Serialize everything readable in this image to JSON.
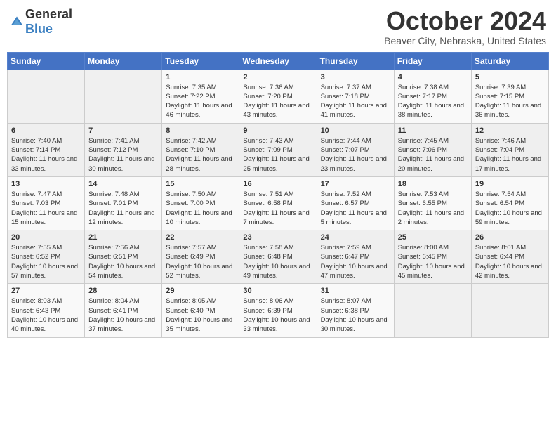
{
  "header": {
    "logo": {
      "general": "General",
      "blue": "Blue"
    },
    "title": "October 2024",
    "subtitle": "Beaver City, Nebraska, United States"
  },
  "weekdays": [
    "Sunday",
    "Monday",
    "Tuesday",
    "Wednesday",
    "Thursday",
    "Friday",
    "Saturday"
  ],
  "weeks": [
    [
      {
        "day": "",
        "info": ""
      },
      {
        "day": "",
        "info": ""
      },
      {
        "day": "1",
        "sunrise": "Sunrise: 7:35 AM",
        "sunset": "Sunset: 7:22 PM",
        "daylight": "Daylight: 11 hours and 46 minutes."
      },
      {
        "day": "2",
        "sunrise": "Sunrise: 7:36 AM",
        "sunset": "Sunset: 7:20 PM",
        "daylight": "Daylight: 11 hours and 43 minutes."
      },
      {
        "day": "3",
        "sunrise": "Sunrise: 7:37 AM",
        "sunset": "Sunset: 7:18 PM",
        "daylight": "Daylight: 11 hours and 41 minutes."
      },
      {
        "day": "4",
        "sunrise": "Sunrise: 7:38 AM",
        "sunset": "Sunset: 7:17 PM",
        "daylight": "Daylight: 11 hours and 38 minutes."
      },
      {
        "day": "5",
        "sunrise": "Sunrise: 7:39 AM",
        "sunset": "Sunset: 7:15 PM",
        "daylight": "Daylight: 11 hours and 36 minutes."
      }
    ],
    [
      {
        "day": "6",
        "sunrise": "Sunrise: 7:40 AM",
        "sunset": "Sunset: 7:14 PM",
        "daylight": "Daylight: 11 hours and 33 minutes."
      },
      {
        "day": "7",
        "sunrise": "Sunrise: 7:41 AM",
        "sunset": "Sunset: 7:12 PM",
        "daylight": "Daylight: 11 hours and 30 minutes."
      },
      {
        "day": "8",
        "sunrise": "Sunrise: 7:42 AM",
        "sunset": "Sunset: 7:10 PM",
        "daylight": "Daylight: 11 hours and 28 minutes."
      },
      {
        "day": "9",
        "sunrise": "Sunrise: 7:43 AM",
        "sunset": "Sunset: 7:09 PM",
        "daylight": "Daylight: 11 hours and 25 minutes."
      },
      {
        "day": "10",
        "sunrise": "Sunrise: 7:44 AM",
        "sunset": "Sunset: 7:07 PM",
        "daylight": "Daylight: 11 hours and 23 minutes."
      },
      {
        "day": "11",
        "sunrise": "Sunrise: 7:45 AM",
        "sunset": "Sunset: 7:06 PM",
        "daylight": "Daylight: 11 hours and 20 minutes."
      },
      {
        "day": "12",
        "sunrise": "Sunrise: 7:46 AM",
        "sunset": "Sunset: 7:04 PM",
        "daylight": "Daylight: 11 hours and 17 minutes."
      }
    ],
    [
      {
        "day": "13",
        "sunrise": "Sunrise: 7:47 AM",
        "sunset": "Sunset: 7:03 PM",
        "daylight": "Daylight: 11 hours and 15 minutes."
      },
      {
        "day": "14",
        "sunrise": "Sunrise: 7:48 AM",
        "sunset": "Sunset: 7:01 PM",
        "daylight": "Daylight: 11 hours and 12 minutes."
      },
      {
        "day": "15",
        "sunrise": "Sunrise: 7:50 AM",
        "sunset": "Sunset: 7:00 PM",
        "daylight": "Daylight: 11 hours and 10 minutes."
      },
      {
        "day": "16",
        "sunrise": "Sunrise: 7:51 AM",
        "sunset": "Sunset: 6:58 PM",
        "daylight": "Daylight: 11 hours and 7 minutes."
      },
      {
        "day": "17",
        "sunrise": "Sunrise: 7:52 AM",
        "sunset": "Sunset: 6:57 PM",
        "daylight": "Daylight: 11 hours and 5 minutes."
      },
      {
        "day": "18",
        "sunrise": "Sunrise: 7:53 AM",
        "sunset": "Sunset: 6:55 PM",
        "daylight": "Daylight: 11 hours and 2 minutes."
      },
      {
        "day": "19",
        "sunrise": "Sunrise: 7:54 AM",
        "sunset": "Sunset: 6:54 PM",
        "daylight": "Daylight: 10 hours and 59 minutes."
      }
    ],
    [
      {
        "day": "20",
        "sunrise": "Sunrise: 7:55 AM",
        "sunset": "Sunset: 6:52 PM",
        "daylight": "Daylight: 10 hours and 57 minutes."
      },
      {
        "day": "21",
        "sunrise": "Sunrise: 7:56 AM",
        "sunset": "Sunset: 6:51 PM",
        "daylight": "Daylight: 10 hours and 54 minutes."
      },
      {
        "day": "22",
        "sunrise": "Sunrise: 7:57 AM",
        "sunset": "Sunset: 6:49 PM",
        "daylight": "Daylight: 10 hours and 52 minutes."
      },
      {
        "day": "23",
        "sunrise": "Sunrise: 7:58 AM",
        "sunset": "Sunset: 6:48 PM",
        "daylight": "Daylight: 10 hours and 49 minutes."
      },
      {
        "day": "24",
        "sunrise": "Sunrise: 7:59 AM",
        "sunset": "Sunset: 6:47 PM",
        "daylight": "Daylight: 10 hours and 47 minutes."
      },
      {
        "day": "25",
        "sunrise": "Sunrise: 8:00 AM",
        "sunset": "Sunset: 6:45 PM",
        "daylight": "Daylight: 10 hours and 45 minutes."
      },
      {
        "day": "26",
        "sunrise": "Sunrise: 8:01 AM",
        "sunset": "Sunset: 6:44 PM",
        "daylight": "Daylight: 10 hours and 42 minutes."
      }
    ],
    [
      {
        "day": "27",
        "sunrise": "Sunrise: 8:03 AM",
        "sunset": "Sunset: 6:43 PM",
        "daylight": "Daylight: 10 hours and 40 minutes."
      },
      {
        "day": "28",
        "sunrise": "Sunrise: 8:04 AM",
        "sunset": "Sunset: 6:41 PM",
        "daylight": "Daylight: 10 hours and 37 minutes."
      },
      {
        "day": "29",
        "sunrise": "Sunrise: 8:05 AM",
        "sunset": "Sunset: 6:40 PM",
        "daylight": "Daylight: 10 hours and 35 minutes."
      },
      {
        "day": "30",
        "sunrise": "Sunrise: 8:06 AM",
        "sunset": "Sunset: 6:39 PM",
        "daylight": "Daylight: 10 hours and 33 minutes."
      },
      {
        "day": "31",
        "sunrise": "Sunrise: 8:07 AM",
        "sunset": "Sunset: 6:38 PM",
        "daylight": "Daylight: 10 hours and 30 minutes."
      },
      {
        "day": "",
        "info": ""
      },
      {
        "day": "",
        "info": ""
      }
    ]
  ]
}
